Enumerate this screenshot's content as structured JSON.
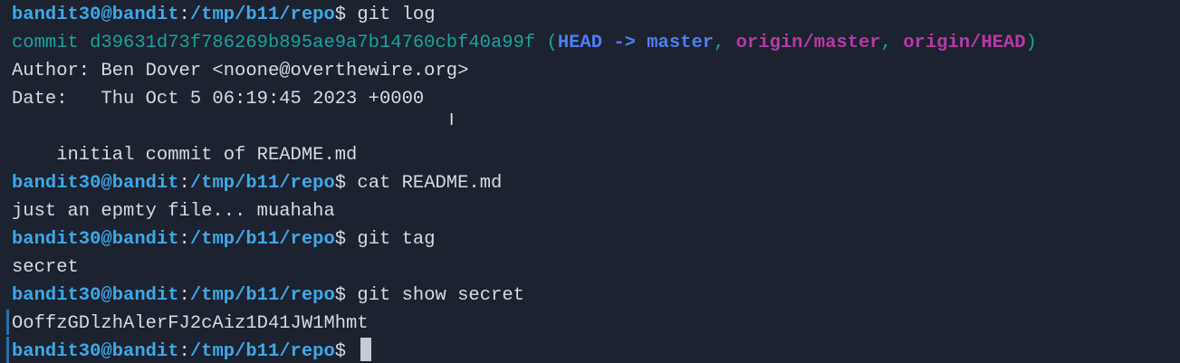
{
  "prompt": {
    "user": "bandit30@bandit",
    "colon": ":",
    "path": "/tmp/b11/repo",
    "dollar": "$ "
  },
  "cmd1": "git log",
  "commit": {
    "word": "commit d39631d73f786269b895ae9a7b14760cbf40a99f ",
    "open_paren": "(",
    "head": "HEAD",
    "arrow": " -> ",
    "branch": "master",
    "sep1": ", ",
    "remote1": "origin/master",
    "sep2": ", ",
    "remote2": "origin/HEAD",
    "close_paren": ")"
  },
  "author_line": "Author: Ben Dover <noone@overthewire.org>",
  "date_line": "Date:   Thu Oct 5 06:19:45 2023 +0000",
  "blank_line": "",
  "message_line": "    initial commit of README.md",
  "cmd2": "cat README.md",
  "readme_output": "just an epmty file... muahaha",
  "cmd3": "git tag",
  "tag_output": "secret",
  "cmd4": "git show secret",
  "secret_output": "OoffzGDlzhAlerFJ2cAiz1D41JW1Mhmt",
  "ibeam_glyph": "I",
  "colors": {
    "background": "#1c2230",
    "prompt": "#3ea9e8",
    "commit_hash": "#1aa39a",
    "head_branch": "#4f7ff0",
    "remote_branch": "#b63aa6",
    "text": "#d6dbe4"
  }
}
